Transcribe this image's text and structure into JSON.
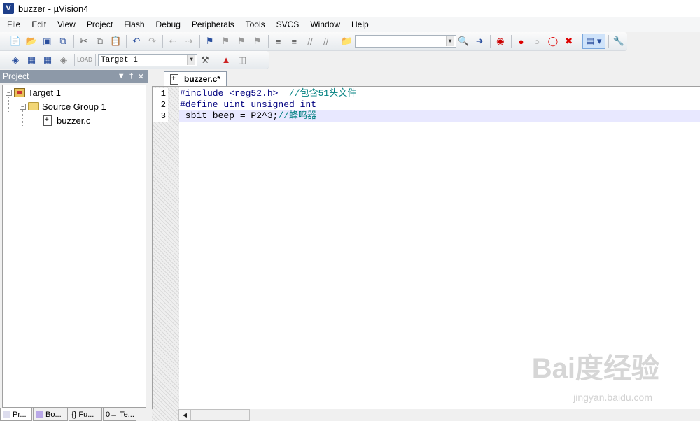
{
  "window": {
    "title": "buzzer  - µVision4",
    "icon": "uvision-logo-icon"
  },
  "menu": [
    {
      "label": "File"
    },
    {
      "label": "Edit"
    },
    {
      "label": "View"
    },
    {
      "label": "Project"
    },
    {
      "label": "Flash"
    },
    {
      "label": "Debug"
    },
    {
      "label": "Peripherals"
    },
    {
      "label": "Tools"
    },
    {
      "label": "SVCS"
    },
    {
      "label": "Window"
    },
    {
      "label": "Help"
    }
  ],
  "toolbar1": {
    "search_combo_value": "",
    "buttons": [
      "new-file-icon",
      "open-icon",
      "save-icon",
      "save-all-icon",
      "cut-icon",
      "copy-icon",
      "paste-icon",
      "undo-icon",
      "redo-icon",
      "back-icon",
      "forward-icon",
      "bookmark-icon",
      "prev-bookmark-icon",
      "next-bookmark-icon",
      "clear-bookmarks-icon",
      "indent-icon",
      "unindent-icon",
      "comment-icon",
      "uncomment-icon",
      "find-in-files-icon",
      "find-icon",
      "incremental-find-icon",
      "debug-icon",
      "breakpoint-icon",
      "disable-breakpoint-icon",
      "disable-all-breakpoints-icon",
      "kill-breakpoints-icon",
      "window-layout-icon",
      "configure-icon"
    ]
  },
  "toolbar2": {
    "target_select": "Target 1",
    "buttons": [
      "translate-icon",
      "build-icon",
      "rebuild-icon",
      "batch-build-icon",
      "stop-build-icon",
      "download-icon",
      "target-options-icon",
      "manage-components-icon",
      "select-packs-icon"
    ]
  },
  "project_panel": {
    "title": "Project",
    "tree": {
      "target": "Target 1",
      "group": "Source Group 1",
      "file": "buzzer.c"
    },
    "bottom_tabs": [
      "Pr...",
      "Bo...",
      "Fu...",
      "Te..."
    ]
  },
  "editor": {
    "tab_label": "buzzer.c*",
    "lines": [
      {
        "num": "1",
        "text": "#include <reg52.h>  ",
        "comment": "//包含51头文件"
      },
      {
        "num": "2",
        "text": "#define uint unsigned int",
        "comment": ""
      },
      {
        "num": "3",
        "text": " sbit beep = P2^3;",
        "comment": "//蜂鸣器"
      }
    ]
  },
  "watermark": {
    "main": "Bai度经验",
    "sub": "jingyan.baidu.com"
  }
}
